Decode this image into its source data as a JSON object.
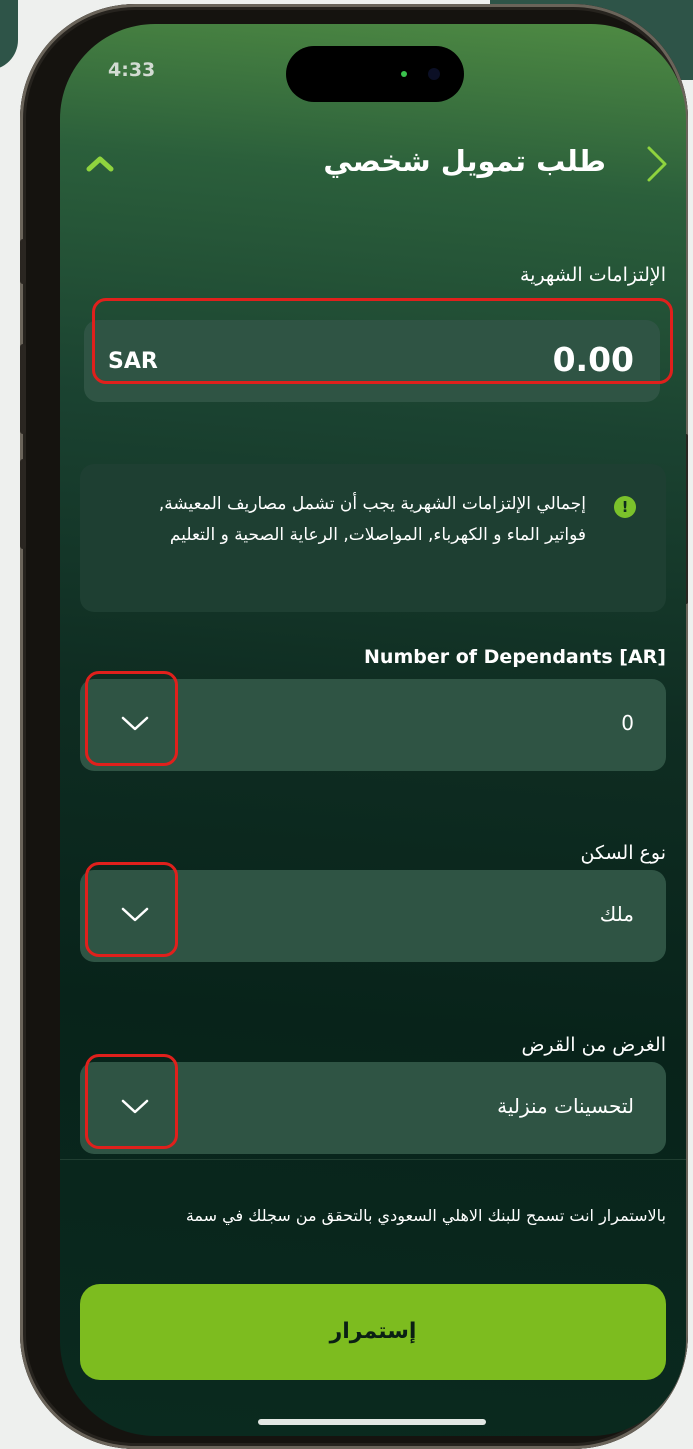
{
  "status_bar": {
    "time": "4:33"
  },
  "header": {
    "title": "طلب تمويل شخصي"
  },
  "monthly_obligations": {
    "label": "الإلتزامات الشهرية",
    "currency": "SAR",
    "value": "0.00"
  },
  "info_message": "إجمالي الإلتزامات الشهرية يجب أن تشمل مصاريف المعيشة, فواتير الماء و الكهرباء, المواصلات, الرعاية الصحية و التعليم",
  "dependants": {
    "label": "Number of Dependants [AR]",
    "value": "0"
  },
  "housing_type": {
    "label": "نوع السكن",
    "value": "ملك"
  },
  "loan_purpose": {
    "label": "الغرض من القرض",
    "value": "لتحسينات منزلية"
  },
  "consent_text": "بالاستمرار انت تسمح للبنك الاهلي السعودي بالتحقق من سجلك في سمة",
  "continue_button": {
    "label": "إستمرار"
  },
  "colors": {
    "accent_green": "#7dbc1f",
    "field_bg": "#2f5444",
    "highlight_red": "#e0201c"
  },
  "icons": {
    "back": "chevron-right-icon",
    "collapse": "chevron-up-icon",
    "dropdown": "chevron-down-icon",
    "info": "exclamation-icon"
  }
}
